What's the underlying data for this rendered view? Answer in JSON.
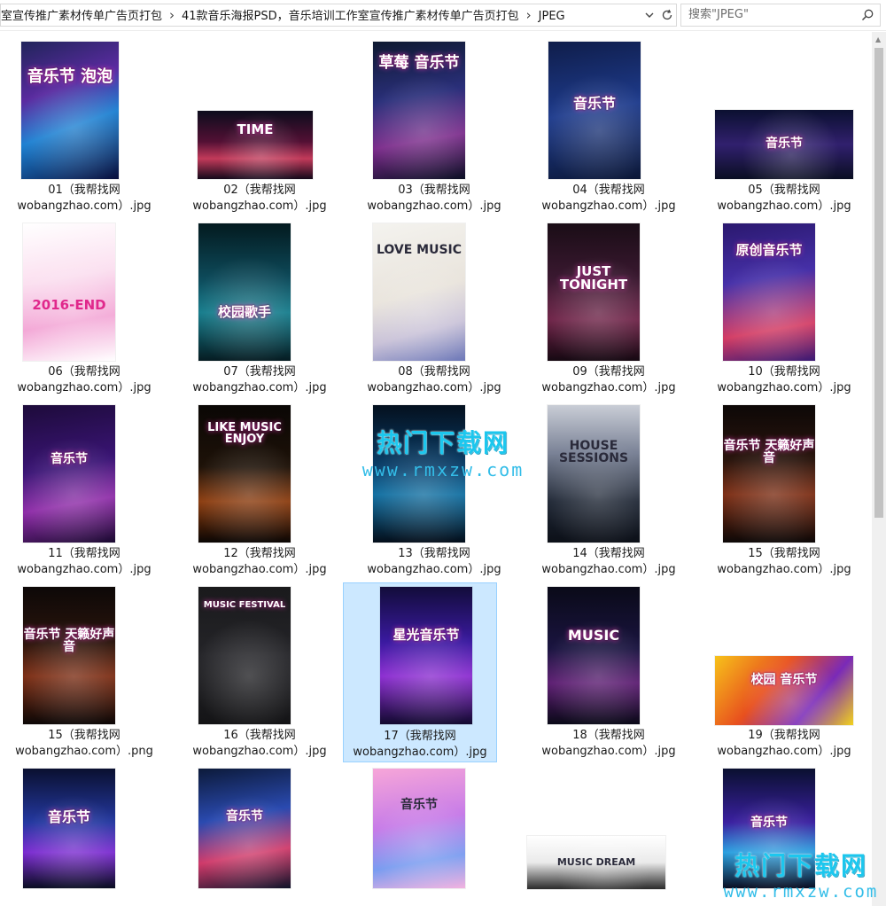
{
  "address_bar": {
    "crumbs": [
      "室宣传推广素材传单广告页打包",
      "41款音乐海报PSD，音乐培训工作室宣传推广素材传单广告页打包",
      "JPEG"
    ],
    "separator": "›"
  },
  "search": {
    "text": "搜索\"JPEG\""
  },
  "watermark": {
    "title": "热门下载网",
    "url": "www.rmxzw.com"
  },
  "files": [
    {
      "line1": "01（我帮找网",
      "line2": "wobangzhao.com）.jpg",
      "poster": "音乐节 泡泡"
    },
    {
      "line1": "02（我帮找网",
      "line2": "wobangzhao.com）.jpg",
      "poster": "TIME"
    },
    {
      "line1": "03（我帮找网",
      "line2": "wobangzhao.com）.jpg",
      "poster": "草莓 音乐节"
    },
    {
      "line1": "04（我帮找网",
      "line2": "wobangzhao.com）.jpg",
      "poster": "音乐节"
    },
    {
      "line1": "05（我帮找网",
      "line2": "wobangzhao.com）.jpg",
      "poster": "音乐节"
    },
    {
      "line1": "06（我帮找网",
      "line2": "wobangzhao.com）.jpg",
      "poster": "2016-END"
    },
    {
      "line1": "07（我帮找网",
      "line2": "wobangzhao.com）.jpg",
      "poster": "校园歌手"
    },
    {
      "line1": "08（我帮找网",
      "line2": "wobangzhao.com）.jpg",
      "poster": "LOVE MUSIC"
    },
    {
      "line1": "09（我帮找网",
      "line2": "wobangzhao.com）.jpg",
      "poster": "JUST TONIGHT"
    },
    {
      "line1": "10（我帮找网",
      "line2": "wobangzhao.com）.jpg",
      "poster": "原创音乐节"
    },
    {
      "line1": "11（我帮找网",
      "line2": "wobangzhao.com）.jpg",
      "poster": "音乐节"
    },
    {
      "line1": "12（我帮找网",
      "line2": "wobangzhao.com）.jpg",
      "poster": "LIKE MUSIC ENJOY"
    },
    {
      "line1": "13（我帮找网",
      "line2": "wobangzhao.com）.jpg",
      "poster": ""
    },
    {
      "line1": "14（我帮找网",
      "line2": "wobangzhao.com）.jpg",
      "poster": "HOUSE SESSIONS"
    },
    {
      "line1": "15（我帮找网",
      "line2": "wobangzhao.com）.jpg",
      "poster": "音乐节 天籁好声音"
    },
    {
      "line1": "15（我帮找网",
      "line2": "wobangzhao.com）.png",
      "poster": "音乐节 天籁好声音"
    },
    {
      "line1": "16（我帮找网",
      "line2": "wobangzhao.com）.jpg",
      "poster": "MUSIC FESTIVAL"
    },
    {
      "line1": "17（我帮找网",
      "line2": "wobangzhao.com）.jpg",
      "poster": "星光音乐节"
    },
    {
      "line1": "18（我帮找网",
      "line2": "wobangzhao.com）.jpg",
      "poster": "MUSIC"
    },
    {
      "line1": "19（我帮找网",
      "line2": "wobangzhao.com）.jpg",
      "poster": "校园 音乐节"
    },
    {
      "line1": "",
      "line2": "",
      "poster": "音乐节"
    },
    {
      "line1": "",
      "line2": "",
      "poster": "音乐节"
    },
    {
      "line1": "",
      "line2": "",
      "poster": "音乐节"
    },
    {
      "line1": "",
      "line2": "",
      "poster": "MUSIC DREAM"
    },
    {
      "line1": "",
      "line2": "",
      "poster": "音乐节"
    }
  ]
}
